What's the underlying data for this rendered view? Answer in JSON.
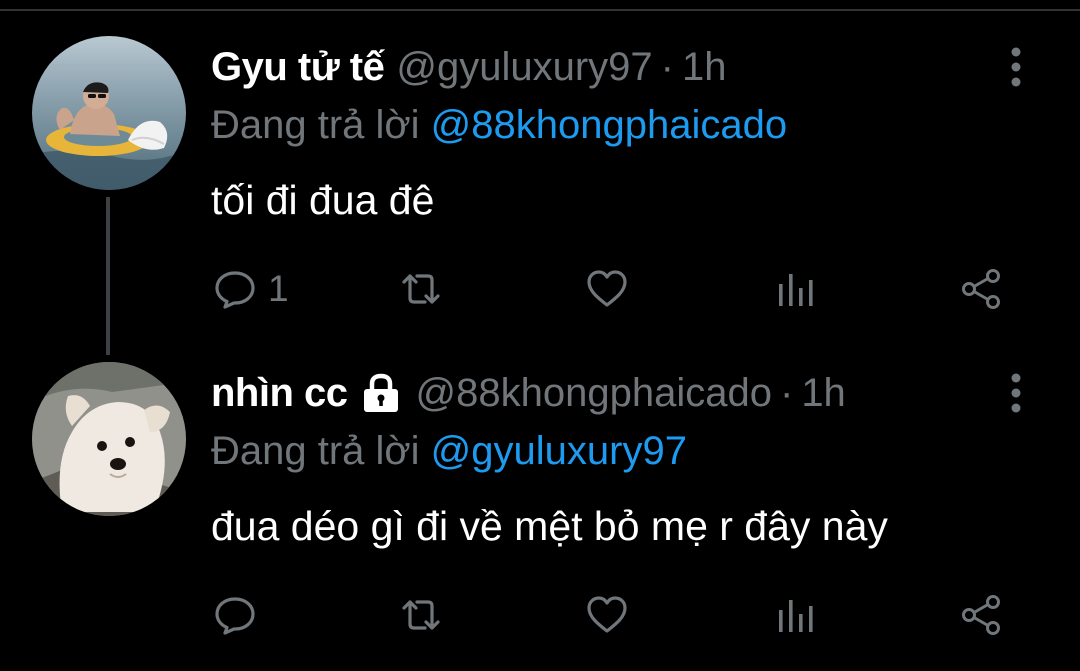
{
  "tweets": [
    {
      "display_name": "Gyu tử tế",
      "handle": "@gyuluxury97",
      "separator": "·",
      "time": "1h",
      "protected": false,
      "replying_label": "Đang trả lời",
      "replying_to": "@88khongphaicado",
      "text": "tối đi đua đê",
      "reply_count": "1",
      "avatar": "avatar-man-on-float-in-sea"
    },
    {
      "display_name": "nhìn cc",
      "handle": "@88khongphaicado",
      "separator": "·",
      "time": "1h",
      "protected": true,
      "replying_label": "Đang trả lời",
      "replying_to": "@gyuluxury97",
      "text": "đua déo gì đi về mệt bỏ mẹ r đây này",
      "reply_count": "",
      "avatar": "avatar-white-dog"
    }
  ],
  "icons": {
    "more": "more-vertical-icon",
    "reply": "reply-bubble-icon",
    "retweet": "retweet-icon",
    "like": "heart-icon",
    "stats": "bar-chart-icon",
    "share": "share-icon",
    "lock": "lock-icon"
  },
  "colors": {
    "background": "#000000",
    "text": "#ffffff",
    "secondary": "#71767b",
    "link": "#1d9bf0",
    "thread_line": "#3e4144"
  }
}
